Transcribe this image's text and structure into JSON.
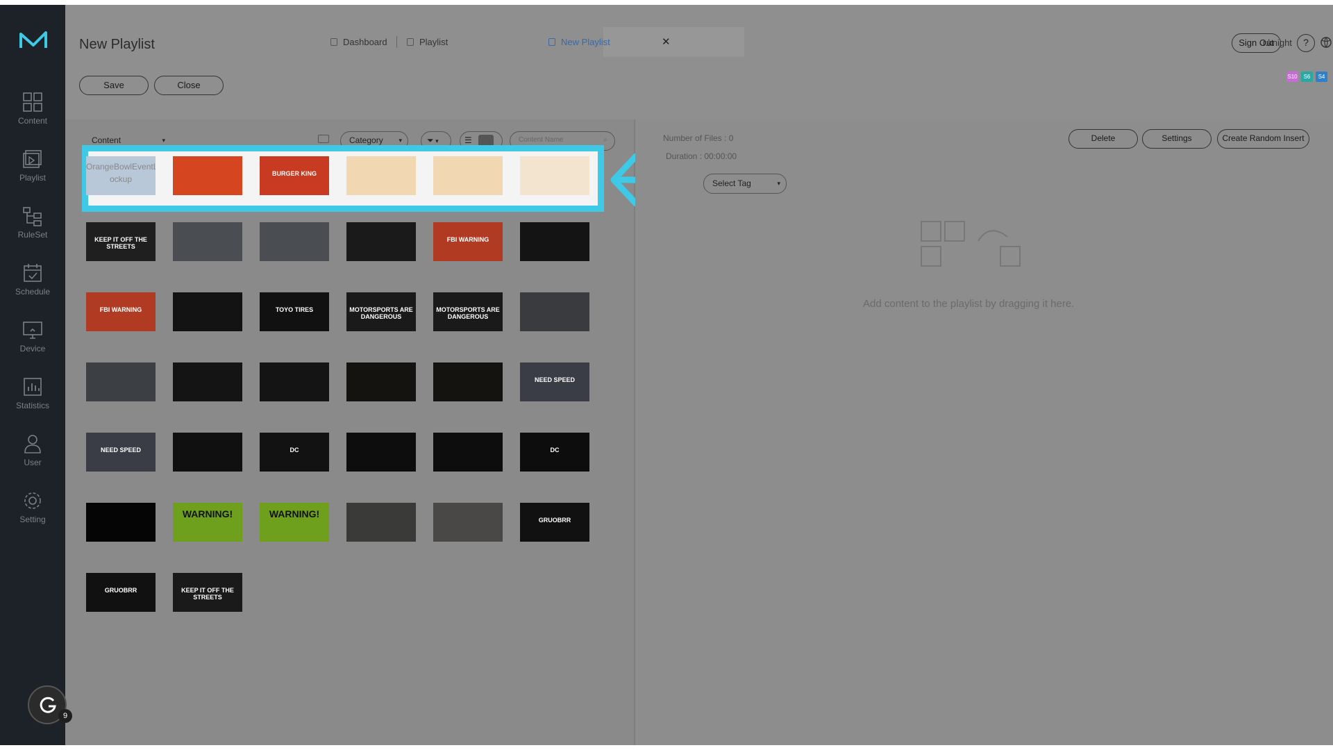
{
  "app": {
    "page_title": "New Playlist",
    "user": "r.knight",
    "sign_out": "Sign Out",
    "help": "?"
  },
  "tabs": [
    {
      "label": "Dashboard"
    },
    {
      "label": "Playlist"
    },
    {
      "label": "New Playlist",
      "active": true
    }
  ],
  "toolbar": {
    "save_label": "Save",
    "close_label": "Close"
  },
  "badges": [
    {
      "label": "S10",
      "color": "#c86bd6"
    },
    {
      "label": "S6",
      "color": "#2aa8a4"
    },
    {
      "label": "S4",
      "color": "#2f7fc9"
    }
  ],
  "sidebar": {
    "items": [
      {
        "label": "Content",
        "icon": "grid-icon"
      },
      {
        "label": "Playlist",
        "icon": "playlist-icon"
      },
      {
        "label": "RuleSet",
        "icon": "ruleset-icon"
      },
      {
        "label": "Schedule",
        "icon": "calendar-icon"
      },
      {
        "label": "Device",
        "icon": "monitor-icon"
      },
      {
        "label": "Statistics",
        "icon": "bar-chart-icon"
      },
      {
        "label": "User",
        "icon": "user-icon"
      },
      {
        "label": "Setting",
        "icon": "gear-icon"
      }
    ]
  },
  "left": {
    "content_select": "Content",
    "category_select": "Category",
    "search_placeholder": "Content Name",
    "first_item_caption": "OrangeBowlEventL ockup"
  },
  "thumbnails": [
    {
      "label": "",
      "bg": "#b8c8d8"
    },
    {
      "label": "",
      "bg": "#d5451f"
    },
    {
      "label": "BURGER KING",
      "bg": "#c83b22"
    },
    {
      "label": "",
      "bg": "#f1d7b2"
    },
    {
      "label": "",
      "bg": "#f1d7b2"
    },
    {
      "label": "",
      "bg": "#f3e4d0"
    },
    {
      "label": "KEEP IT OFF THE STREETS",
      "bg": "#1f1f1f"
    },
    {
      "label": "",
      "bg": "#4a4d52"
    },
    {
      "label": "",
      "bg": "#4a4d52"
    },
    {
      "label": "",
      "bg": "#1a1a1a"
    },
    {
      "label": "FBI WARNING",
      "bg": "#b13b22"
    },
    {
      "label": "",
      "bg": "#141414"
    },
    {
      "label": "FBI WARNING",
      "bg": "#b13b22"
    },
    {
      "label": "",
      "bg": "#131313"
    },
    {
      "label": "TOYO TIRES",
      "bg": "#111111"
    },
    {
      "label": "MOTORSPORTS ARE DANGEROUS",
      "bg": "#1a1a1a"
    },
    {
      "label": "MOTORSPORTS ARE DANGEROUS",
      "bg": "#1a1a1a"
    },
    {
      "label": "",
      "bg": "#3a3b3e"
    },
    {
      "label": "",
      "bg": "#3c3f44"
    },
    {
      "label": "",
      "bg": "#141414"
    },
    {
      "label": "",
      "bg": "#141414"
    },
    {
      "label": "",
      "bg": "#15130f"
    },
    {
      "label": "",
      "bg": "#15130f"
    },
    {
      "label": "NEED SPEED",
      "bg": "#3a3d46"
    },
    {
      "label": "NEED SPEED",
      "bg": "#3a3d46"
    },
    {
      "label": "",
      "bg": "#101010"
    },
    {
      "label": "DC",
      "bg": "#121212"
    },
    {
      "label": "",
      "bg": "#0d0d0d"
    },
    {
      "label": "",
      "bg": "#0d0d0d"
    },
    {
      "label": "DC",
      "bg": "#0d0d0d"
    },
    {
      "label": "",
      "bg": "#050505"
    },
    {
      "label": "WARNING!",
      "bg": "#6fa01d"
    },
    {
      "label": "WARNING!",
      "bg": "#6fa01d"
    },
    {
      "label": "",
      "bg": "#3a3a38"
    },
    {
      "label": "",
      "bg": "#4a4846"
    },
    {
      "label": "GRUOBRR",
      "bg": "#111111"
    },
    {
      "label": "GRUOBRR",
      "bg": "#111111"
    },
    {
      "label": "KEEP IT OFF THE STREETS",
      "bg": "#1a1a1a"
    }
  ],
  "right": {
    "number_of_files": "Number of Files : 0",
    "duration": "Duration : 00:00:00",
    "delete_label": "Delete",
    "settings_label": "Settings",
    "random_insert_label": "Create Random Insert",
    "tag_select": "Select Tag",
    "empty_hint": "Add content to the playlist by dragging it here."
  },
  "grammarly": {
    "count": "9"
  },
  "colors": {
    "highlight": "#3ec9e6",
    "sidebar_bg": "#1d2228",
    "logo": "#3ec9e6"
  }
}
